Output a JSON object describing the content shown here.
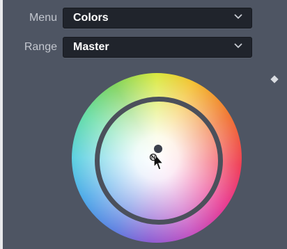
{
  "controls": {
    "menu": {
      "label": "Menu",
      "value": "Colors"
    },
    "range": {
      "label": "Range",
      "value": "Master"
    }
  },
  "icons": {
    "dropdown": "chevron-down-icon",
    "keyframe": "diamond-icon",
    "cursor": "move-cursor-icon"
  },
  "colors": {
    "panel_bg": "#4e5563",
    "field_bg": "#20242c",
    "label_text": "#c3c7cf",
    "value_text": "#ffffff",
    "ring": "#4b505b"
  }
}
